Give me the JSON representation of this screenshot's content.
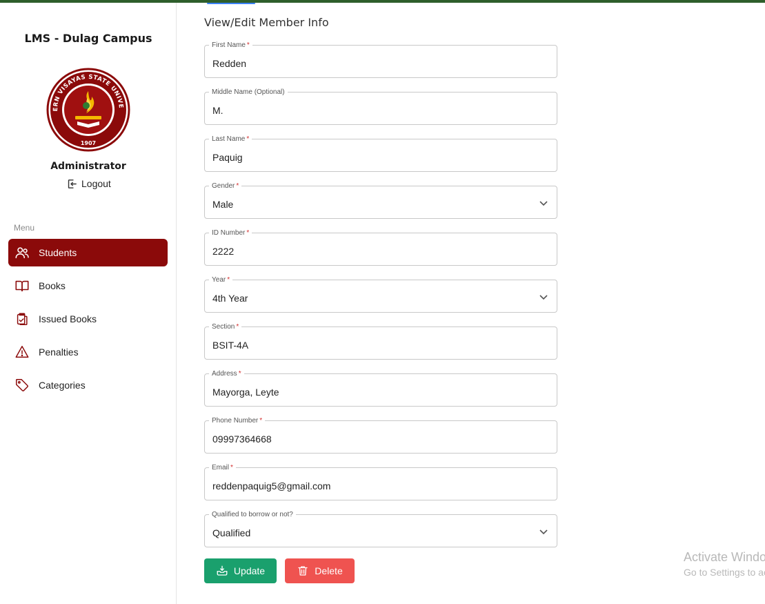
{
  "sidebar": {
    "app_title": "LMS - Dulag Campus",
    "logo": {
      "text_top": "EASTERN VISAYAS STATE UNIVERSITY",
      "year": "1907",
      "colors": {
        "ring": "#8b0a0a",
        "fill": "#a01010",
        "flame": "#f5b800"
      }
    },
    "role": "Administrator",
    "logout_label": "Logout",
    "menu_label": "Menu",
    "items": [
      {
        "label": "Students",
        "icon": "users-icon",
        "active": true
      },
      {
        "label": "Books",
        "icon": "book-icon",
        "active": false
      },
      {
        "label": "Issued Books",
        "icon": "clipboard-check-icon",
        "active": false
      },
      {
        "label": "Penalties",
        "icon": "warning-icon",
        "active": false
      },
      {
        "label": "Categories",
        "icon": "tag-icon",
        "active": false
      }
    ]
  },
  "main": {
    "title": "View/Edit Member Info",
    "fields": {
      "first_name": {
        "label": "First Name",
        "required": "*",
        "value": "Redden"
      },
      "middle_name": {
        "label": "Middle Name (Optional)",
        "value": "M."
      },
      "last_name": {
        "label": "Last Name",
        "required": "*",
        "value": "Paquig"
      },
      "gender": {
        "label": "Gender",
        "required": "*",
        "value": "Male",
        "type": "select"
      },
      "id_number": {
        "label": "ID Number",
        "required": "*",
        "value": "2222"
      },
      "year": {
        "label": "Year",
        "required": "*",
        "value": "4th Year",
        "type": "select"
      },
      "section": {
        "label": "Section",
        "required": "*",
        "value": "BSIT-4A"
      },
      "address": {
        "label": "Address",
        "required": "*",
        "value": "Mayorga, Leyte"
      },
      "phone": {
        "label": "Phone Number",
        "required": "*",
        "value": "09997364668"
      },
      "email": {
        "label": "Email",
        "required": "*",
        "value": "reddenpaquig5@gmail.com"
      },
      "qualified": {
        "label": "Qualified to borrow or not?",
        "value": "Qualified",
        "type": "select"
      }
    },
    "buttons": {
      "update_label": "Update",
      "delete_label": "Delete"
    }
  },
  "watermark": {
    "line1": "Activate Windows",
    "line2": "Go to Settings to activate Windows."
  },
  "colors": {
    "accent": "#8b0a0a",
    "update": "#1aa06d",
    "delete": "#ef5350",
    "topbar": "#2e5e2b"
  }
}
